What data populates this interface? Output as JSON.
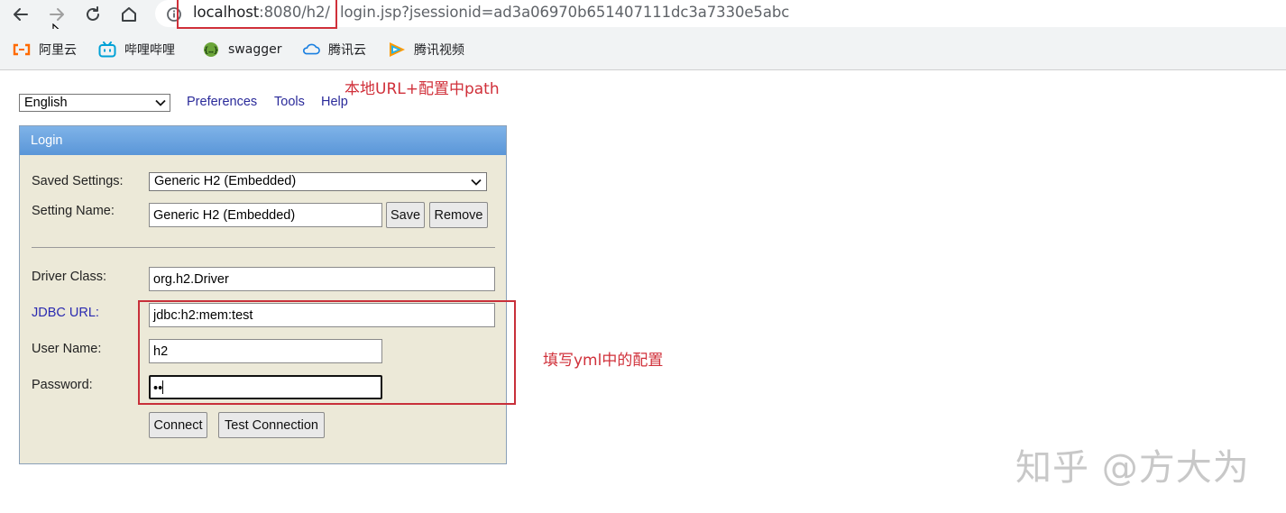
{
  "browser": {
    "url_host_main": "localhost",
    "url_host_rest": ":8080/h2/",
    "url_query": "login.jsp?jsessionid=ad3a06970b651407111dc3a7330e5abc",
    "bookmarks": [
      {
        "label": "阿里云",
        "icon": "aliyun-icon"
      },
      {
        "label": "哔哩哔哩",
        "icon": "bilibili-icon"
      },
      {
        "label": "swagger",
        "icon": "swagger-icon"
      },
      {
        "label": "腾讯云",
        "icon": "tencent-cloud-icon"
      },
      {
        "label": "腾讯视频",
        "icon": "tencent-video-icon"
      }
    ]
  },
  "toolbar": {
    "language": "English",
    "links": [
      "Preferences",
      "Tools",
      "Help"
    ]
  },
  "annotations": {
    "top": "本地URL+配置中path",
    "right": "填写yml中的配置"
  },
  "login": {
    "title": "Login",
    "saved_settings_label": "Saved Settings:",
    "saved_settings_value": "Generic H2 (Embedded)",
    "setting_name_label": "Setting Name:",
    "setting_name_value": "Generic H2 (Embedded)",
    "save_label": "Save",
    "remove_label": "Remove",
    "driver_class_label": "Driver Class:",
    "driver_class_value": "org.h2.Driver",
    "jdbc_url_label": "JDBC URL:",
    "jdbc_url_value": "jdbc:h2:mem:test",
    "user_name_label": "User Name:",
    "user_name_value": "h2",
    "password_label": "Password:",
    "password_value": "••",
    "connect_label": "Connect",
    "test_connection_label": "Test Connection"
  },
  "watermark": "知乎 @方大为",
  "colors": {
    "annotation_red": "#d0303a",
    "header_blue": "#6aa4e0",
    "panel_bg": "#ece9d8"
  }
}
